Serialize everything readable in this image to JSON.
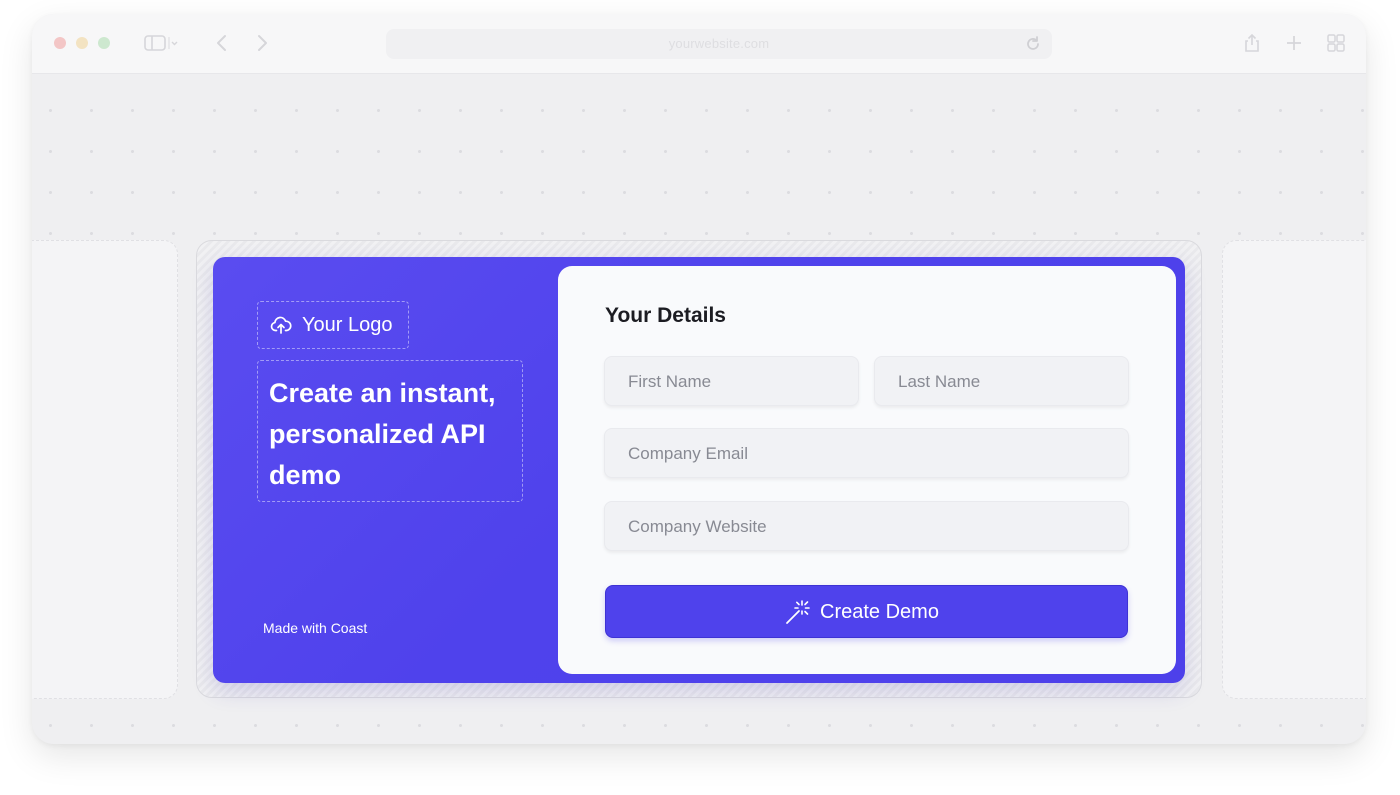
{
  "browser": {
    "url": "yourwebsite.com",
    "icons": [
      "sidebar-icon",
      "chevron-left-icon",
      "chevron-right-icon",
      "reload-icon",
      "share-icon",
      "plus-icon",
      "grid-icon"
    ]
  },
  "brand_panel": {
    "logo_text": "Your Logo",
    "logo_icon": "cloud-upload-icon",
    "headline": "Create an instant, personalized API demo",
    "footer": "Made with Coast"
  },
  "form": {
    "title": "Your Details",
    "first_name_placeholder": "First Name",
    "last_name_placeholder": "Last Name",
    "email_placeholder": "Company Email",
    "website_placeholder": "Company Website",
    "submit_label": "Create Demo",
    "submit_icon": "magic-wand-icon"
  },
  "colors": {
    "accent": "#4f42ec",
    "panel": "#f9fafc",
    "field": "#f1f2f5"
  }
}
